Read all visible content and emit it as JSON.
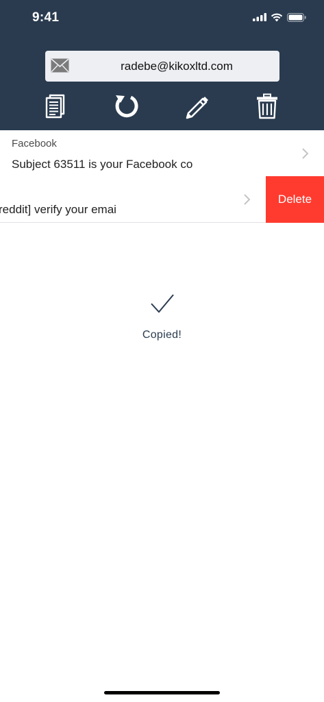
{
  "status_bar": {
    "time": "9:41"
  },
  "email": {
    "address": "radebe@kikoxltd.com"
  },
  "toolbar": {
    "copy": "copy-icon",
    "refresh": "refresh-icon",
    "edit": "pencil-icon",
    "delete": "trash-icon"
  },
  "messages": [
    {
      "sender": "Facebook",
      "subject": "Subject 63511 is your Facebook co"
    },
    {
      "subject": "reddit] verify your emai",
      "delete_label": "Delete"
    }
  ],
  "toast": {
    "text": "Copied!"
  },
  "colors": {
    "header": "#2a3b4f",
    "delete": "#ff3b30",
    "accent": "#2a3b4f"
  }
}
